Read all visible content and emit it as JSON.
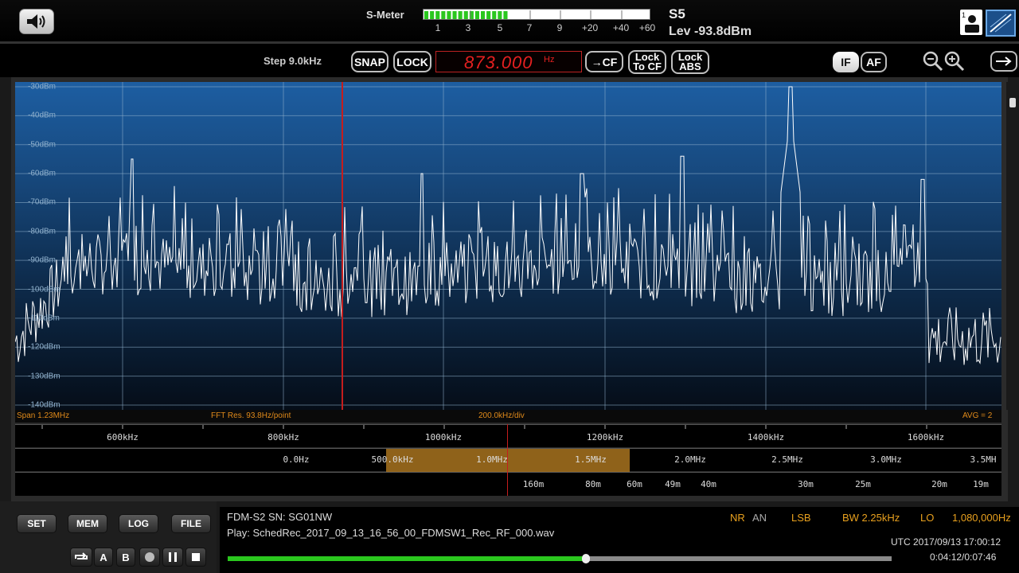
{
  "header": {
    "smeter_label": "S-Meter",
    "smeter_scale": [
      "1",
      "3",
      "5",
      "7",
      "9",
      "+20",
      "+40",
      "+60"
    ],
    "smeter_level": 0.37,
    "s_value": "S5",
    "lev_value": "Lev -93.8dBm",
    "icons": [
      "speaker-icon",
      "profile-icon",
      "display-mode-icon"
    ]
  },
  "toolbar": {
    "step_label": "Step 9.0kHz",
    "snap_label": "SNAP",
    "lock_label": "LOCK",
    "frequency": "873.000",
    "frequency_unit": "Hz",
    "to_cf_label": "CF",
    "lock_to_cf_line1": "Lock",
    "lock_to_cf_line2": "To CF",
    "lock_abs_line1": "Lock",
    "lock_abs_line2": "ABS",
    "if_label": "IF",
    "af_label": "AF"
  },
  "spectrum": {
    "db_labels": [
      "-30dBm",
      "-40dBm",
      "-50dBm",
      "-60dBm",
      "-70dBm",
      "-80dBm",
      "-90dBm",
      "-100dBm",
      "-110dBm",
      "-120dBm",
      "-130dBm",
      "-140dBm"
    ],
    "span": "Span 1.23MHz",
    "fft_res": "FFT Res. 93.8Hz/point",
    "div": "200.0kHz/div",
    "avg": "AVG = 2"
  },
  "scales": {
    "khz": [
      "600kHz",
      "800kHz",
      "1000kHz",
      "1200kHz",
      "1400kHz",
      "1600kHz"
    ],
    "mhz": [
      "0.0Hz",
      "500.0kHz",
      "1.0MHz",
      "1.5MHz",
      "2.0MHz",
      "2.5MHz",
      "3.0MHz",
      "3.5MH"
    ],
    "bands": [
      "160m",
      "80m",
      "60m",
      "49m",
      "40m",
      "30m",
      "25m",
      "20m",
      "19m"
    ]
  },
  "bottom": {
    "set_label": "SET",
    "mem_label": "MEM",
    "log_label": "LOG",
    "file_label": "FILE",
    "a_label": "A",
    "b_label": "B",
    "device": "FDM-S2 SN: SG01NW",
    "play_file": "Play: SchedRec_2017_09_13_16_56_00_FDMSW1_Rec_RF_000.wav",
    "nr": "NR",
    "an": "AN",
    "mode": "LSB",
    "bw": "BW 2.25kHz",
    "lo_label": "LO",
    "lo_value": "1,080,000Hz",
    "utc": "UTC 2017/09/13 17:00:12",
    "time": "0:04:12/0:07:46",
    "progress": 0.54
  },
  "colors": {
    "accent_green": "#2ac71e",
    "freq_red": "#e52020",
    "info_orange": "#e08a1a",
    "range_amber": "#a3701e"
  }
}
